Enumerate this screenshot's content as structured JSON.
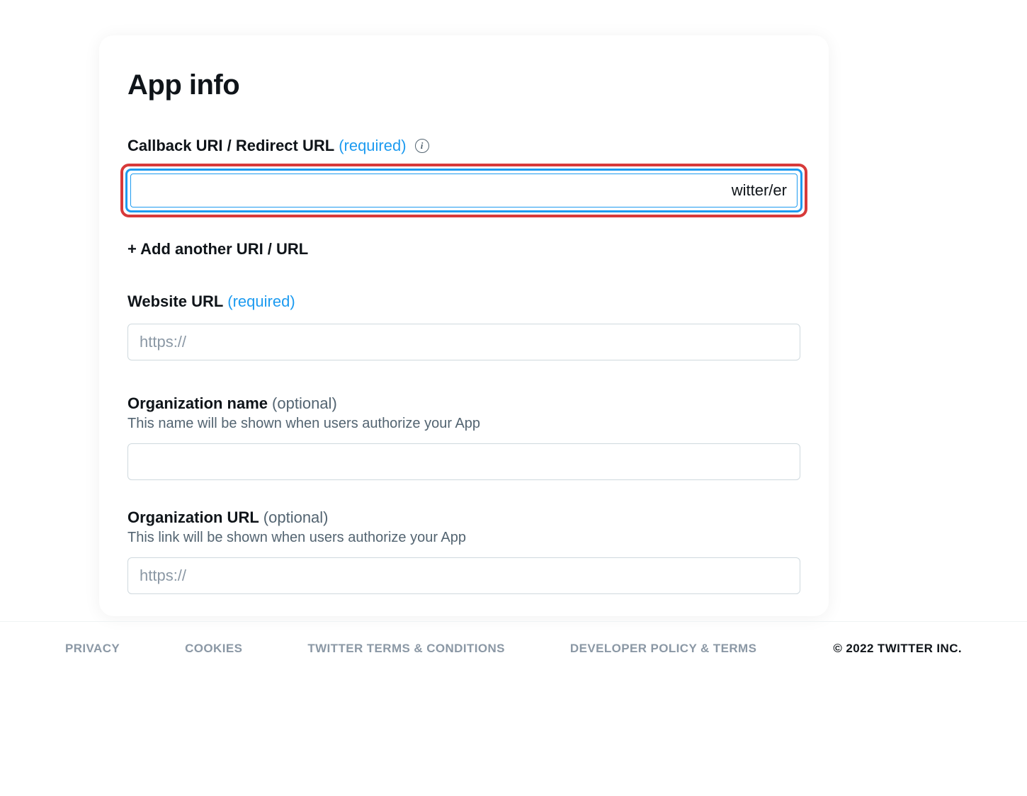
{
  "card": {
    "title": "App info",
    "callback": {
      "label": "Callback URI / Redirect URL",
      "required_tag": "(required)",
      "value": "witter/er",
      "add_label": "+ Add another URI / URL"
    },
    "website": {
      "label": "Website URL",
      "required_tag": "(required)",
      "placeholder": "https://",
      "value": ""
    },
    "org_name": {
      "label": "Organization name",
      "optional_tag": "(optional)",
      "hint": "This name will be shown when users authorize your App",
      "value": ""
    },
    "org_url": {
      "label": "Organization URL",
      "optional_tag": "(optional)",
      "hint": "This link will be shown when users authorize your App",
      "placeholder": "https://",
      "value": ""
    }
  },
  "footer": {
    "links": [
      "Privacy",
      "Cookies",
      "Twitter Terms & Conditions",
      "Developer Policy & Terms"
    ],
    "copyright": "© 2022 TWITTER INC."
  }
}
